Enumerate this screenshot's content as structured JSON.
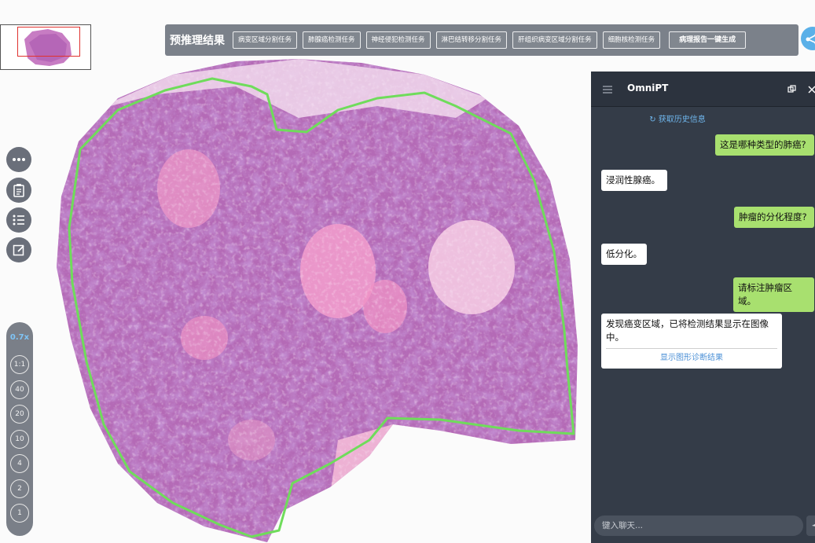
{
  "toolbar": {
    "title": "预推理结果",
    "tasks": [
      "病变区域分割任务",
      "肺腺癌检测任务",
      "神经侵犯检测任务",
      "淋巴结转移分割任务",
      "肝组织病变区域分割任务",
      "细胞核检测任务"
    ],
    "report_button": "病理报告一键生成"
  },
  "zoom": {
    "current": "0.7x",
    "levels": [
      "1:1",
      "40",
      "20",
      "10",
      "4",
      "2",
      "1"
    ]
  },
  "chat": {
    "title": "OmniPT",
    "history_link": "获取历史信息",
    "messages": [
      {
        "role": "user",
        "text": "这是哪种类型的肺癌?"
      },
      {
        "role": "bot",
        "text": "浸润性腺癌。"
      },
      {
        "role": "user",
        "text": "肿瘤的分化程度?"
      },
      {
        "role": "bot",
        "text": "低分化。"
      },
      {
        "role": "user",
        "text": "请标注肿瘤区域。"
      },
      {
        "role": "bot",
        "text": "发现癌变区域，已将检测结果显示在图像中。"
      }
    ],
    "diagnosis_link": "显示图形诊断结果",
    "input_placeholder": "键入聊天..."
  },
  "colors": {
    "tissue_dark": "#8a4aa6",
    "tissue_pink": "#e98fc4",
    "annotation": "#6fdc5b",
    "panel": "#343c48",
    "user_bubble": "#a8e06f",
    "link": "#6fb7ee"
  },
  "icons": [
    "more-icon",
    "clipboard-icon",
    "list-icon",
    "edit-icon",
    "refresh-icon",
    "menu-icon",
    "copy-icon",
    "close-icon",
    "share-icon",
    "send-icon"
  ]
}
